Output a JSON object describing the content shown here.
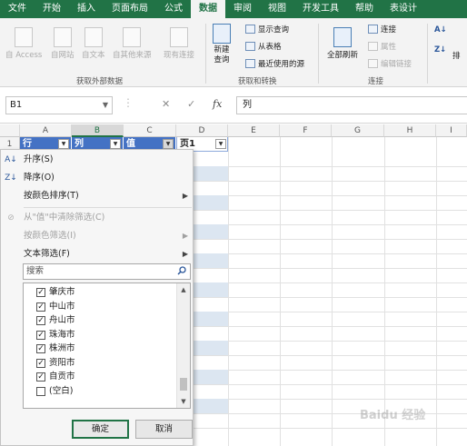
{
  "ribbon_tabs": [
    "文件",
    "开始",
    "插入",
    "页面布局",
    "公式",
    "数据",
    "审阅",
    "视图",
    "开发工具",
    "帮助",
    "表设计"
  ],
  "active_tab": "数据",
  "ribbon": {
    "get_external": {
      "label": "获取外部数据",
      "buttons": [
        "自 Access",
        "自网站",
        "自文本",
        "自其他来源",
        "现有连接"
      ]
    },
    "get_transform": {
      "label": "获取和转换",
      "new_query": "新建\n查询",
      "show_query": "显示查询",
      "from_table": "从表格",
      "recent_sources": "最近使用的源"
    },
    "connections": {
      "label": "连接",
      "refresh_all": "全部刷新",
      "connections": "连接",
      "properties": "属性",
      "edit_links": "编辑链接"
    },
    "sort_edge": "排"
  },
  "formula_bar": {
    "name_box": "B1",
    "cancel": "✕",
    "enter": "✓",
    "fx": "fx",
    "content": "列"
  },
  "grid": {
    "columns": [
      "A",
      "B",
      "C",
      "D",
      "E",
      "F",
      "G",
      "H",
      "I"
    ],
    "row_numbers": [
      "1"
    ],
    "header_cells": [
      "行",
      "列",
      "值",
      "页1"
    ]
  },
  "filter_menu": {
    "sort_asc": "升序(S)",
    "sort_desc": "降序(O)",
    "sort_color": "按颜色排序(T)",
    "clear_filter": "从\"值\"中清除筛选(C)",
    "filter_color": "按颜色筛选(I)",
    "text_filter": "文本筛选(F)",
    "search_placeholder": "搜索",
    "items": [
      {
        "label": "肇庆市",
        "checked": true
      },
      {
        "label": "中山市",
        "checked": true
      },
      {
        "label": "舟山市",
        "checked": true
      },
      {
        "label": "珠海市",
        "checked": true
      },
      {
        "label": "株洲市",
        "checked": true
      },
      {
        "label": "资阳市",
        "checked": true
      },
      {
        "label": "自贡市",
        "checked": true
      },
      {
        "label": "(空白)",
        "checked": false
      }
    ],
    "ok_label": "确定",
    "cancel_label": "取消"
  },
  "watermark": "Baidu 经验",
  "colors": {
    "accent": "#217346",
    "table_header": "#4472c4",
    "band": "#dce6f1"
  }
}
